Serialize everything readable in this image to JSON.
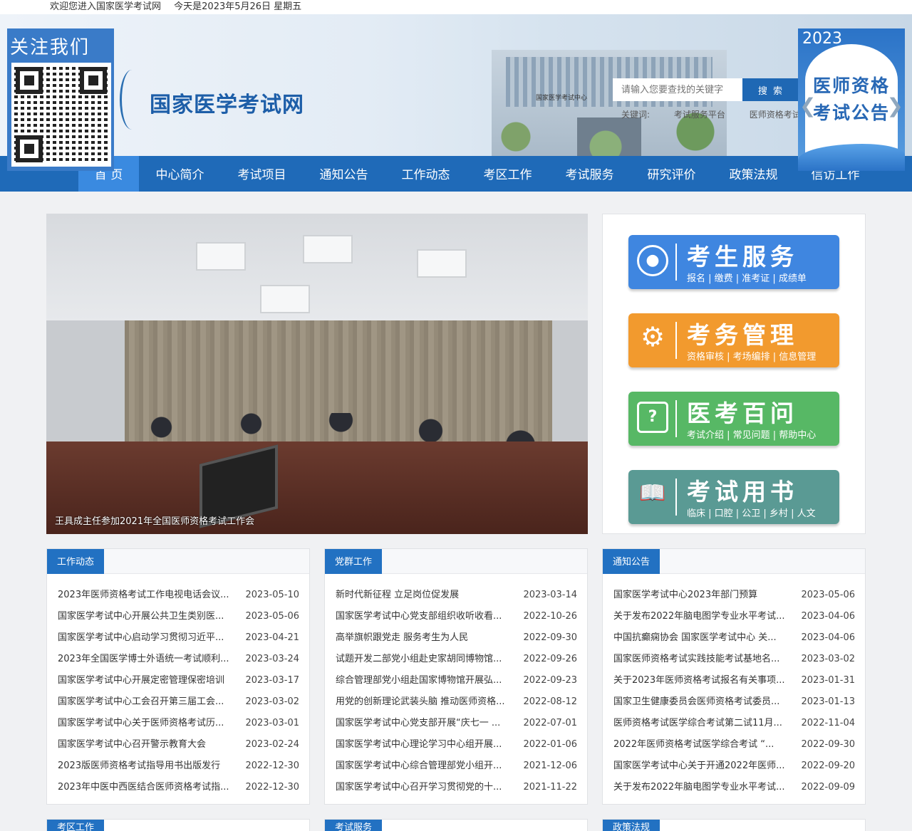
{
  "topbar": {
    "welcome": "欢迎您进入国家医学考试网",
    "date": "今天是2023年5月26日 星期五"
  },
  "header": {
    "site_name": "国家医学考试网",
    "building_sign": "国家医学考试中心",
    "search_placeholder": "请输入您要查找的关键字",
    "search_button": "搜 索",
    "keywords_label": "关键词:",
    "keywords": [
      "考试服务平台",
      "医师资格考试"
    ]
  },
  "follow": {
    "title": "关注我们"
  },
  "notice": {
    "year": "2023",
    "text": "医师资格考试公告"
  },
  "nav": [
    "首 页",
    "中心简介",
    "考试项目",
    "通知公告",
    "工作动态",
    "考区工作",
    "考试服务",
    "研究评价",
    "政策法规",
    "信访工作"
  ],
  "slider": {
    "caption": "王具成主任参加2021年全国医师资格考试工作会"
  },
  "services": [
    {
      "title": "考生服务",
      "sub": "报名 | 缴费 | 准考证 | 成绩单",
      "color": "#3f86e0",
      "icon": "user-icon"
    },
    {
      "title": "考务管理",
      "sub": "资格审核 | 考场编排 | 信息管理",
      "color": "#f29a2e",
      "icon": "gear-icon"
    },
    {
      "title": "医考百问",
      "sub": "考试介绍 | 常见问题 | 帮助中心",
      "color": "#57b865",
      "icon": "question-icon"
    },
    {
      "title": "考试用书",
      "sub": "临床 | 口腔 | 公卫 | 乡村 | 人文",
      "color": "#5a9a94",
      "icon": "book-icon"
    }
  ],
  "panels": [
    {
      "title": "工作动态",
      "items": [
        [
          "2023年医师资格考试工作电视电话会议...",
          "2023-05-10"
        ],
        [
          "国家医学考试中心开展公共卫生类别医...",
          "2023-05-06"
        ],
        [
          "国家医学考试中心启动学习贯彻习近平...",
          "2023-04-21"
        ],
        [
          "2023年全国医学博士外语统一考试顺利...",
          "2023-03-24"
        ],
        [
          "国家医学考试中心开展定密管理保密培训",
          "2023-03-17"
        ],
        [
          "国家医学考试中心工会召开第三届工会...",
          "2023-03-02"
        ],
        [
          "国家医学考试中心关于医师资格考试历...",
          "2023-03-01"
        ],
        [
          "国家医学考试中心召开警示教育大会",
          "2023-02-24"
        ],
        [
          "2023版医师资格考试指导用书出版发行",
          "2022-12-30"
        ],
        [
          "2023年中医中西医结合医师资格考试指...",
          "2022-12-30"
        ]
      ]
    },
    {
      "title": "党群工作",
      "items": [
        [
          "新时代新征程 立足岗位促发展",
          "2023-03-14"
        ],
        [
          "国家医学考试中心党支部组织收听收看...",
          "2022-10-26"
        ],
        [
          "高举旗帜跟党走 服务考生为人民",
          "2022-09-30"
        ],
        [
          "试题开发二部党小组赴史家胡同博物馆...",
          "2022-09-26"
        ],
        [
          "综合管理部党小组赴国家博物馆开展弘...",
          "2022-09-23"
        ],
        [
          "用党的创新理论武装头脑 推动医师资格...",
          "2022-08-12"
        ],
        [
          "国家医学考试中心党支部开展“庆七一 ...",
          "2022-07-01"
        ],
        [
          "国家医学考试中心理论学习中心组开展...",
          "2022-01-06"
        ],
        [
          "国家医学考试中心综合管理部党小组开...",
          "2021-12-06"
        ],
        [
          "国家医学考试中心召开学习贯彻党的十...",
          "2021-11-22"
        ]
      ]
    },
    {
      "title": "通知公告",
      "items": [
        [
          "国家医学考试中心2023年部门预算",
          "2023-05-06"
        ],
        [
          "关于发布2022年脑电图学专业水平考试...",
          "2023-04-06"
        ],
        [
          "中国抗癫痫协会 国家医学考试中心 关...",
          "2023-04-06"
        ],
        [
          "国家医师资格考试实践技能考试基地名...",
          "2023-03-02"
        ],
        [
          "关于2023年医师资格考试报名有关事项...",
          "2023-01-31"
        ],
        [
          "国家卫生健康委员会医师资格考试委员...",
          "2023-01-13"
        ],
        [
          "医师资格考试医学综合考试第二试11月...",
          "2022-11-04"
        ],
        [
          "2022年医师资格考试医学综合考试 “...",
          "2022-09-30"
        ],
        [
          "国家医学考试中心关于开通2022年医师...",
          "2022-09-20"
        ],
        [
          "关于发布2022年脑电图学专业水平考试...",
          "2022-09-09"
        ]
      ]
    }
  ],
  "bottom_panels": [
    "考区工作",
    "考试服务",
    "政策法规"
  ]
}
